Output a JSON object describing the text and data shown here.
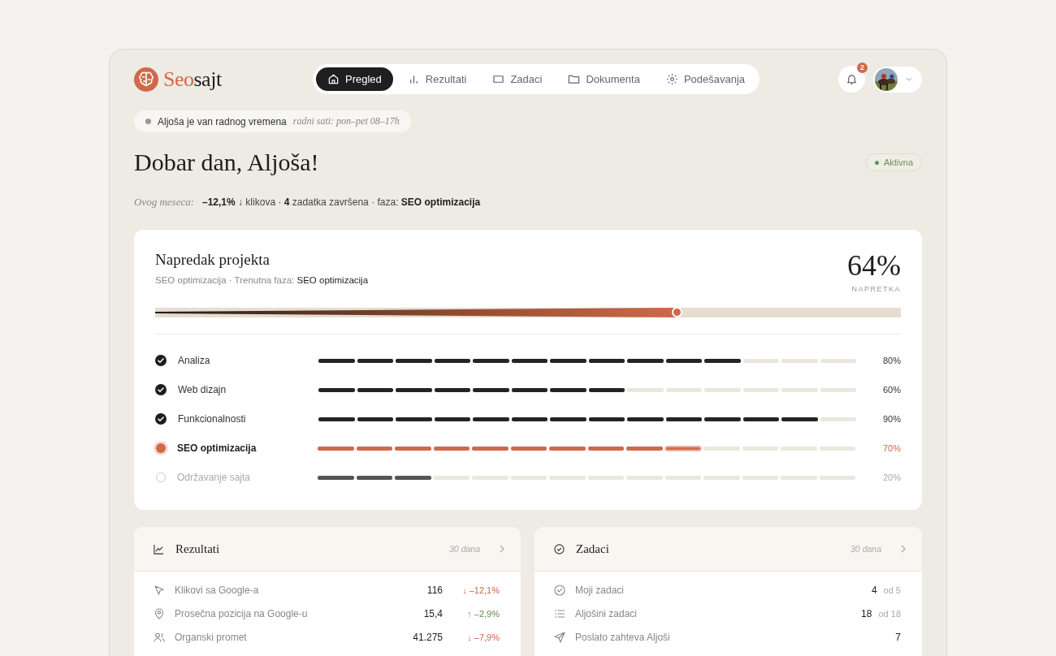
{
  "brand": {
    "accent": "Seo",
    "rest": "sajt"
  },
  "nav": [
    {
      "label": "Pregled",
      "selected": true
    },
    {
      "label": "Rezultati",
      "selected": false
    },
    {
      "label": "Zadaci",
      "selected": false
    },
    {
      "label": "Dokumenta",
      "selected": false
    },
    {
      "label": "Podešavanja",
      "selected": false
    }
  ],
  "notifications": {
    "count": "2"
  },
  "status": {
    "text": "Aljoša je van radnog vremena",
    "hours": "radni sati: pon–pet 08–17h"
  },
  "greeting": "Dobar dan, Aljoša!",
  "badge": {
    "label": "Aktivna",
    "color": "#6a8f5c"
  },
  "summary": {
    "label": "Ovog meseca:",
    "text": "**–12,1%** ↓ klikova · **4** zadatka završena · faza: **SEO optimizacija**"
  },
  "progress": {
    "title": "Napredak projekta",
    "subtitle": "SEO optimizacija · Trenutna faza: **SEO optimizacija**",
    "percent": "64%",
    "caption": "NAPRETKA",
    "level": 0.7,
    "phases": [
      {
        "label": "Analiza",
        "kind": "done",
        "level": 0.8,
        "reading": "80%"
      },
      {
        "label": "Web dizajn",
        "kind": "done",
        "level": 0.6,
        "reading": "60%"
      },
      {
        "label": "Funkcionalnosti",
        "kind": "done",
        "level": 0.9,
        "reading": "90%"
      },
      {
        "label": "SEO optimizacija",
        "kind": "current",
        "level": 0.7,
        "reading": "70%"
      },
      {
        "label": "Održavanje sajta",
        "kind": "pending",
        "level": 0.2,
        "reading": "20%"
      }
    ]
  },
  "results": {
    "title": "Rezultati",
    "period": "30 dana",
    "rows": [
      {
        "label": "Klikovi sa Google-a",
        "value": "116",
        "delta": "↓ –12,1%",
        "good": false
      },
      {
        "label": "Prosečna pozicija na Google-u",
        "value": "15,4",
        "delta": "↑ –2,9%",
        "good": true
      },
      {
        "label": "Organski promet",
        "value": "41.275",
        "delta": "↓ –7,9%",
        "good": false
      }
    ]
  },
  "tasks": {
    "title": "Zadaci",
    "period": "30 dana",
    "rows": [
      {
        "label": "Moji zadaci",
        "value": "4",
        "total": "od 5"
      },
      {
        "label": "Aljošini zadaci",
        "value": "18",
        "total": "od 18"
      },
      {
        "label": "Poslato zahteva Aljoši",
        "value": "7"
      }
    ]
  }
}
